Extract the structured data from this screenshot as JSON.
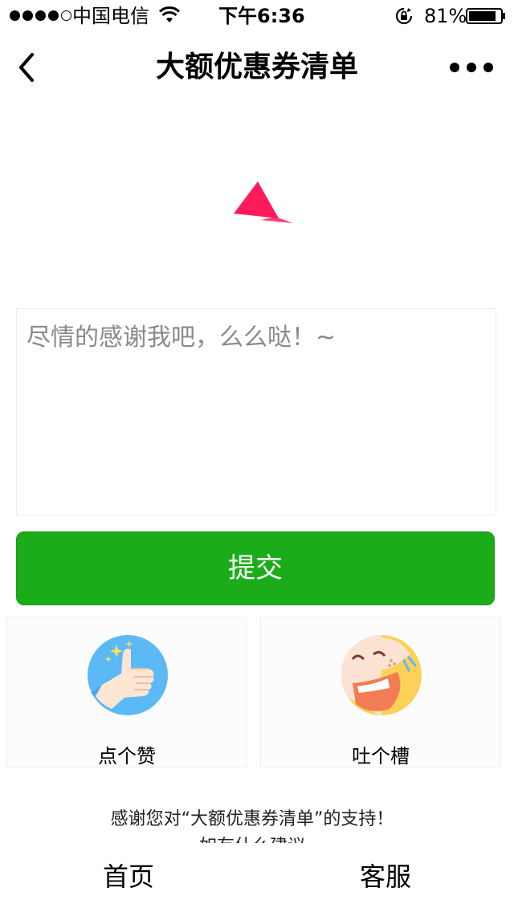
{
  "status_bar": {
    "carrier": "中国电信",
    "time": "下午6:36",
    "battery": "81%"
  },
  "nav": {
    "title": "大额优惠券清单"
  },
  "feedback": {
    "placeholder": "尽情的感谢我吧，么么哒！~"
  },
  "submit_label": "提交",
  "cards": {
    "like_label": "点个赞",
    "roast_label": "吐个槽"
  },
  "thanks": {
    "line1": "感谢您对“大额优惠券清单”的支持！",
    "line2": "如有什么建议"
  },
  "tabs": {
    "home": "首页",
    "service": "客服"
  },
  "colors": {
    "accent": "#1aad19",
    "loader": "#ff1a5c"
  },
  "icons": [
    "wifi-icon",
    "rotation-lock-icon",
    "battery-icon",
    "back-icon",
    "more-icon",
    "loader-icon",
    "thumbs-up-icon",
    "laughing-face-icon"
  ]
}
